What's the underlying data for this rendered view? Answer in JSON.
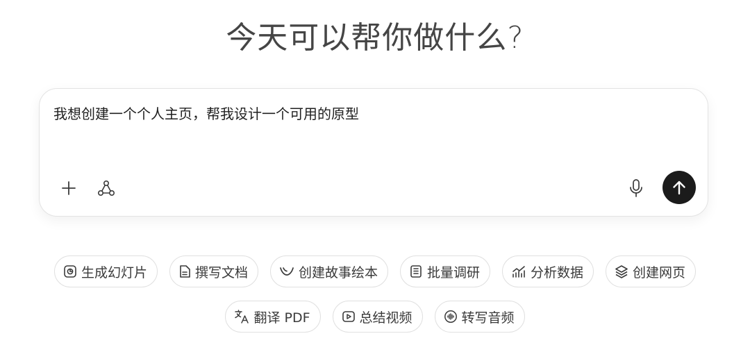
{
  "heading": "今天可以帮你做什么?",
  "composer": {
    "prompt_text": "我想创建一个个人主页，帮我设计一个可用的原型"
  },
  "chips_row1": [
    {
      "label": "生成幻灯片",
      "icon": "slides-icon"
    },
    {
      "label": "撰写文档",
      "icon": "document-icon"
    },
    {
      "label": "创建故事绘本",
      "icon": "storybook-icon"
    },
    {
      "label": "批量调研",
      "icon": "research-icon"
    },
    {
      "label": "分析数据",
      "icon": "analytics-icon"
    },
    {
      "label": "创建网页",
      "icon": "layers-icon"
    }
  ],
  "chips_row2": [
    {
      "label": "翻译 PDF",
      "icon": "translate-icon"
    },
    {
      "label": "总结视频",
      "icon": "video-icon"
    },
    {
      "label": "转写音频",
      "icon": "audio-wave-icon"
    }
  ]
}
